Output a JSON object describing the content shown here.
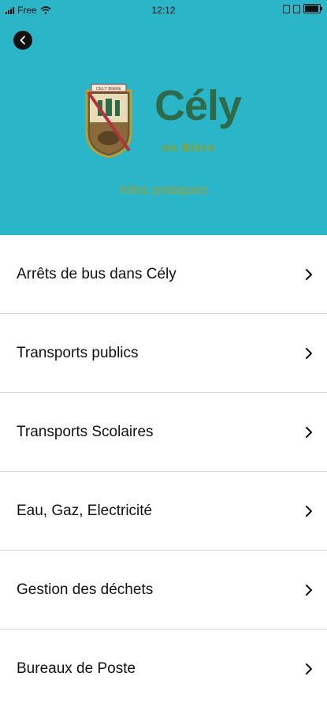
{
  "status_bar": {
    "carrier": "Free",
    "time": "12:12"
  },
  "header": {
    "back_icon": "chevron-left-icon",
    "brand_name": "Cély",
    "brand_sub": "en Bière",
    "crest_banner": "CELY BIERE",
    "section_title": "Infos pratiques",
    "background_color": "#2bb5c8",
    "brand_color": "#2e6b4a",
    "subtitle_color": "#9aa03a"
  },
  "menu": {
    "items": [
      {
        "label": "Arrêts de bus dans Cély",
        "icon": "chevron-right-icon"
      },
      {
        "label": "Transports publics",
        "icon": "chevron-right-icon"
      },
      {
        "label": "Transports Scolaires",
        "icon": "chevron-right-icon"
      },
      {
        "label": "Eau, Gaz, Electricité",
        "icon": "chevron-right-icon"
      },
      {
        "label": "Gestion des déchets",
        "icon": "chevron-right-icon"
      },
      {
        "label": "Bureaux de Poste",
        "icon": "chevron-right-icon"
      }
    ]
  }
}
